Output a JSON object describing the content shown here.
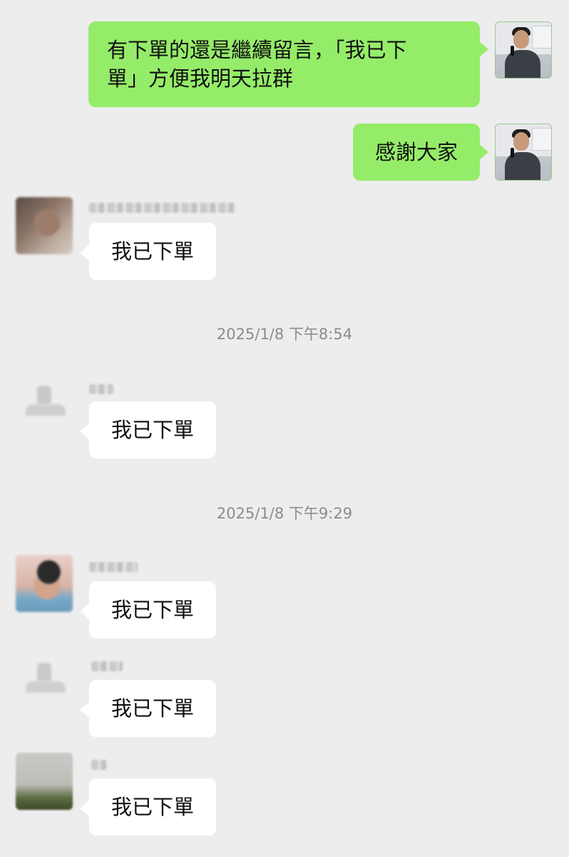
{
  "colors": {
    "background": "#ededed",
    "self_bubble": "#95ec69",
    "other_bubble": "#ffffff",
    "timestamp_text": "#8c8c8c"
  },
  "messages": {
    "m1": {
      "sender": "self",
      "text": "有下單的還是繼續留言，「我已下單」方便我明天拉群",
      "line1": "有下單的還是繼續留言，「我已下",
      "line2": "單」方便我明天拉群"
    },
    "m2": {
      "sender": "self",
      "text": "感謝大家"
    },
    "m3": {
      "sender": "other",
      "text": "我已下單"
    },
    "m4": {
      "sender": "other",
      "text": "我已下單"
    },
    "m5": {
      "sender": "other",
      "text": "我已下單"
    },
    "m6": {
      "sender": "other",
      "text": "我已下單"
    },
    "m7": {
      "sender": "other",
      "text": "我已下單"
    }
  },
  "timestamps": {
    "t1": "2025/1/8 下午8:54",
    "t2": "2025/1/8 下午9:29"
  }
}
